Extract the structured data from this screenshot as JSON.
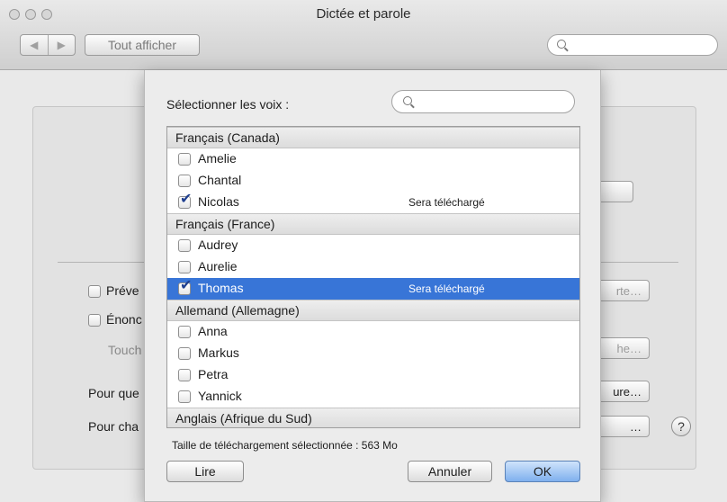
{
  "window": {
    "title": "Dictée et parole"
  },
  "toolbar": {
    "back": "◀",
    "forward": "▶",
    "show_all": "Tout afficher",
    "search_placeholder": ""
  },
  "background": {
    "options": [
      {
        "label": "Préve"
      },
      {
        "label": "Énonc"
      }
    ],
    "touch_label": "Touch",
    "row_pourque": "Pour que",
    "row_pourcha": "Pour cha",
    "btn_a": "rte…",
    "btn_b": "he…",
    "btn_c": "ure…",
    "btn_d": "…",
    "help": "?"
  },
  "sheet": {
    "title": "Sélectionner les voix :",
    "search_placeholder": "",
    "groups": [
      {
        "name": "Français (Canada)",
        "voices": [
          {
            "name": "Amelie",
            "checked": false,
            "status": ""
          },
          {
            "name": "Chantal",
            "checked": false,
            "status": ""
          },
          {
            "name": "Nicolas",
            "checked": true,
            "status": "Sera téléchargé"
          }
        ]
      },
      {
        "name": "Français (France)",
        "voices": [
          {
            "name": "Audrey",
            "checked": false,
            "status": ""
          },
          {
            "name": "Aurelie",
            "checked": false,
            "status": ""
          },
          {
            "name": "Thomas",
            "checked": true,
            "status": "Sera téléchargé",
            "selected": true
          }
        ]
      },
      {
        "name": "Allemand (Allemagne)",
        "voices": [
          {
            "name": "Anna",
            "checked": false,
            "status": ""
          },
          {
            "name": "Markus",
            "checked": false,
            "status": ""
          },
          {
            "name": "Petra",
            "checked": false,
            "status": ""
          },
          {
            "name": "Yannick",
            "checked": false,
            "status": ""
          }
        ]
      },
      {
        "name": "Anglais (Afrique du Sud)",
        "voices": []
      }
    ],
    "size_label": "Taille de téléchargement sélectionnée : 563 Mo",
    "play_button": "Lire",
    "cancel_button": "Annuler",
    "ok_button": "OK"
  }
}
